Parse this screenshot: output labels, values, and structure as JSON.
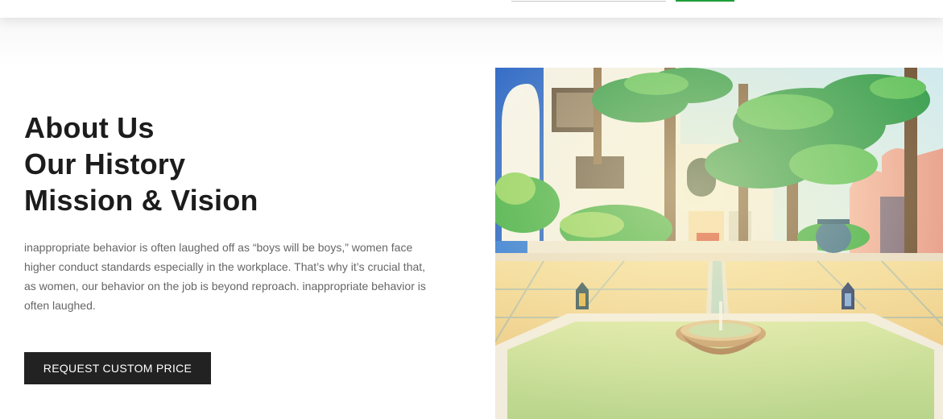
{
  "about": {
    "headings": [
      "About Us",
      "Our History",
      "Mission & Vision"
    ],
    "description": "inappropriate behavior is often laughed off as “boys will be boys,” women face higher conduct standards especially in the workplace. That’s why it’s crucial that, as women, our behavior on the job is beyond reproach. inappropriate behavior is often laughed.",
    "cta_label": "REQUEST CUSTOM PRICE"
  },
  "colors": {
    "accent_green": "#1f9d3a",
    "button_dark": "#222222",
    "heading": "#1c1c1c",
    "body_text": "#666666"
  },
  "image": {
    "subject": "courtyard-with-fountain-and-palm-trees"
  }
}
